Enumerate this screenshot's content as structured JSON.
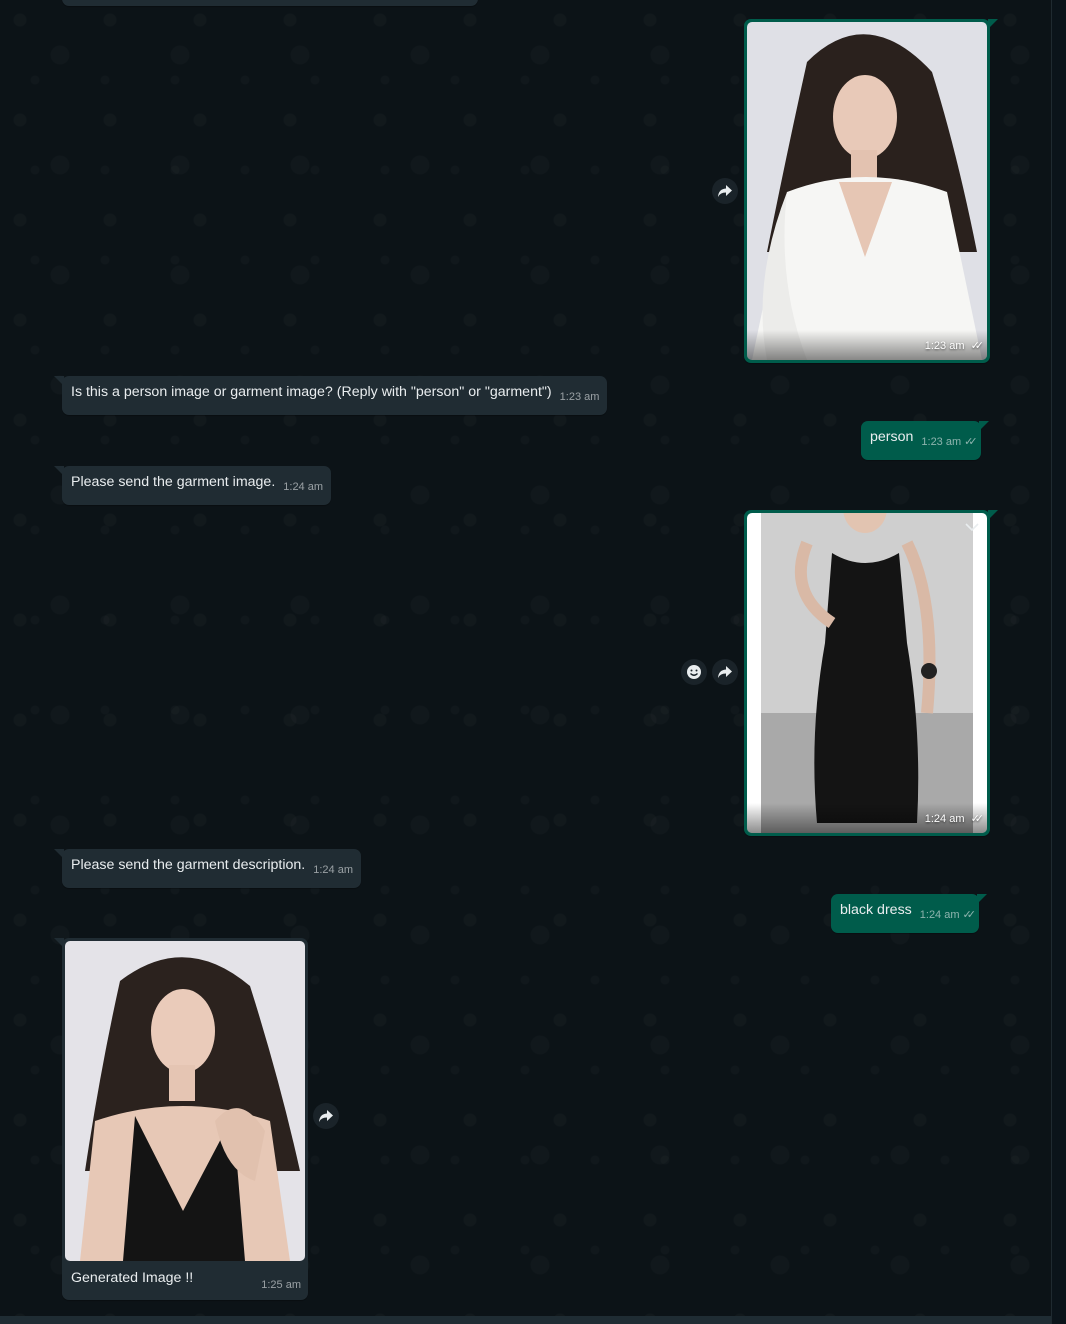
{
  "colors": {
    "background": "#0c1317",
    "incoming_bubble": "#202c33",
    "outgoing_bubble": "#005c4b",
    "text": "#e9edef"
  },
  "messages": [
    {
      "id": "m1",
      "direction": "outgoing",
      "type": "image",
      "image_subject": "woman-in-white-blouse-photo",
      "time": "1:23 am",
      "status_icon": "double-check-icon"
    },
    {
      "id": "m2",
      "direction": "incoming",
      "type": "text",
      "text": "Is this a person image or garment image? (Reply with \"person\" or \"garment\")",
      "time": "1:23 am"
    },
    {
      "id": "m3",
      "direction": "outgoing",
      "type": "text",
      "text": "person",
      "time": "1:23 am",
      "status_icon": "double-check-icon"
    },
    {
      "id": "m4",
      "direction": "incoming",
      "type": "text",
      "text": "Please send the garment image.",
      "time": "1:24 am"
    },
    {
      "id": "m5",
      "direction": "outgoing",
      "type": "image",
      "image_subject": "black-slip-dress-photo",
      "time": "1:24 am",
      "status_icon": "double-check-icon"
    },
    {
      "id": "m6",
      "direction": "incoming",
      "type": "text",
      "text": "Please send the garment description.",
      "time": "1:24 am"
    },
    {
      "id": "m7",
      "direction": "outgoing",
      "type": "text",
      "text": "black dress",
      "time": "1:24 am",
      "status_icon": "double-check-icon"
    },
    {
      "id": "m8",
      "direction": "incoming",
      "type": "image",
      "image_subject": "woman-in-black-dress-photo",
      "caption": "Generated Image !!",
      "time": "1:25 am"
    }
  ]
}
